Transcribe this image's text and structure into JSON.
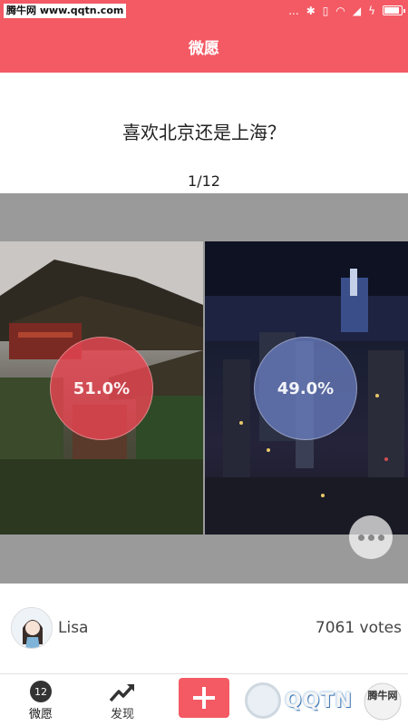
{
  "status_bar": {
    "watermark": "腾牛网 www.qqtn.com",
    "signal": "...",
    "bluetooth_icon": "bluetooth-icon",
    "battery_level": 0.9
  },
  "header": {
    "title": "微愿"
  },
  "question": {
    "text": "喜欢北京还是上海？",
    "counter": "1/12"
  },
  "options": [
    {
      "name": "beijing",
      "percent": "51.0%",
      "color": "#e84652"
    },
    {
      "name": "shanghai",
      "percent": "49.0%",
      "color": "#6e82c8"
    }
  ],
  "user": {
    "name": "Lisa",
    "votes": "7061 votes"
  },
  "nav": {
    "wish_badge": "12",
    "wish_label": "微愿",
    "discover_label": "发现"
  },
  "watermark_bottom": {
    "logo_text": "QQTN",
    "badge_text": "腾牛网"
  },
  "colors": {
    "accent": "#f35a64"
  }
}
